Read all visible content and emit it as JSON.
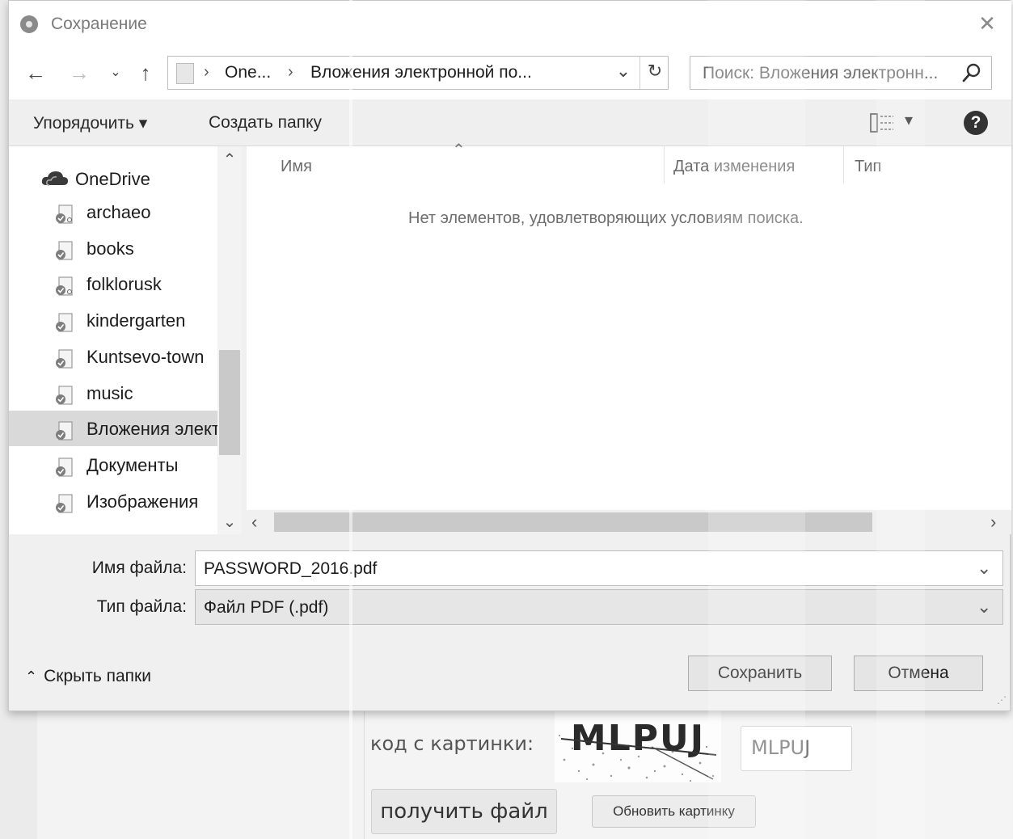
{
  "dialog": {
    "title": "Сохранение",
    "address": {
      "seg1": "One...",
      "seg2": "Вложения электронной по..."
    },
    "search": {
      "placeholder": "Поиск: Вложения электронн..."
    },
    "toolbar": {
      "organize": "Упорядочить ▾",
      "new_folder": "Создать папку"
    },
    "sidebar": {
      "root": "OneDrive",
      "items": [
        {
          "label": "archaeo",
          "selected": false,
          "icon": "shared-folder-icon"
        },
        {
          "label": "books",
          "selected": false,
          "icon": "folder-icon"
        },
        {
          "label": "folklorusk",
          "selected": false,
          "icon": "shared-folder-icon"
        },
        {
          "label": "kindergarten",
          "selected": false,
          "icon": "folder-icon"
        },
        {
          "label": "Kuntsevo-town",
          "selected": false,
          "icon": "folder-icon"
        },
        {
          "label": "music",
          "selected": false,
          "icon": "folder-icon"
        },
        {
          "label": "Вложения элект",
          "selected": true,
          "icon": "folder-icon"
        },
        {
          "label": "Документы",
          "selected": false,
          "icon": "folder-icon"
        },
        {
          "label": "Изображения",
          "selected": false,
          "icon": "folder-icon"
        }
      ]
    },
    "columns": {
      "name": "Имя",
      "date": "Дата изменения",
      "type": "Тип"
    },
    "empty_message": "Нет элементов, удовлетворяющих условиям поиска.",
    "filename": {
      "label": "Имя файла:",
      "value": "PASSWORD_2016.pdf"
    },
    "filetype": {
      "label": "Тип файла:",
      "value": "Файл PDF (.pdf)"
    },
    "hide_folders": "Скрыть папки",
    "save_button": "Сохранить",
    "cancel_button": "Отмена"
  },
  "page": {
    "captcha_label": "код с картинки:",
    "captcha_text": "MLPUJ",
    "captcha_value": "MLPUJ",
    "get_file_button": "получить файл",
    "refresh_captcha_button": "Обновить картинку"
  }
}
